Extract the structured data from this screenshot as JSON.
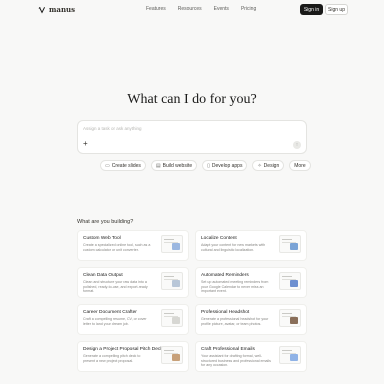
{
  "brand": {
    "name": "manus"
  },
  "nav": {
    "links": [
      "Features",
      "Resources",
      "Events",
      "Pricing"
    ],
    "signin": "Sign in",
    "signup": "Sign up"
  },
  "hero": {
    "title": "What can I do for you?"
  },
  "prompt": {
    "placeholder": "Assign a task or ask anything",
    "plus": "+",
    "send": "↑"
  },
  "chips": [
    {
      "icon": "slides-icon",
      "label": "Create slides"
    },
    {
      "icon": "website-icon",
      "label": "Build website"
    },
    {
      "icon": "mobile-icon",
      "label": "Develop apps"
    },
    {
      "icon": "design-icon",
      "label": "Design"
    },
    {
      "icon": "",
      "label": "More"
    }
  ],
  "section": {
    "label": "What are you building?"
  },
  "cards": [
    {
      "title": "Custom Web Tool",
      "desc": "Create a specialized online tool, such as a custom calculator or unit converter.",
      "accent": "#9bb7e0"
    },
    {
      "title": "Localize Content",
      "desc": "Adapt your content for new markets with cultural and linguistic localization.",
      "accent": "#7aa3d6"
    },
    {
      "title": "Clean Data Output",
      "desc": "Clean and structure your raw data into a polished, ready-to-use, and export-ready format.",
      "accent": "#b9c7d8"
    },
    {
      "title": "Automated Reminders",
      "desc": "Set up automated meeting reminders from your Google Calendar to never miss an important event.",
      "accent": "#6d8fd0"
    },
    {
      "title": "Career Document Crafter",
      "desc": "Craft a compelling resume, CV, or cover letter to land your dream job.",
      "accent": "#d7d7d3"
    },
    {
      "title": "Professional Headshot",
      "desc": "Generate a professional headshot for your profile picture, avatar, or team photos.",
      "accent": "#8a6f5a"
    },
    {
      "title": "Design a Project Proposal Pitch Deck",
      "desc": "Generate a compelling pitch deck to present a new project proposal.",
      "accent": "#c8a17a"
    },
    {
      "title": "Craft Professional Emails",
      "desc": "Your assistant for drafting formal, well-structured business and professional emails for any occasion.",
      "accent": "#8fb2e6"
    }
  ]
}
